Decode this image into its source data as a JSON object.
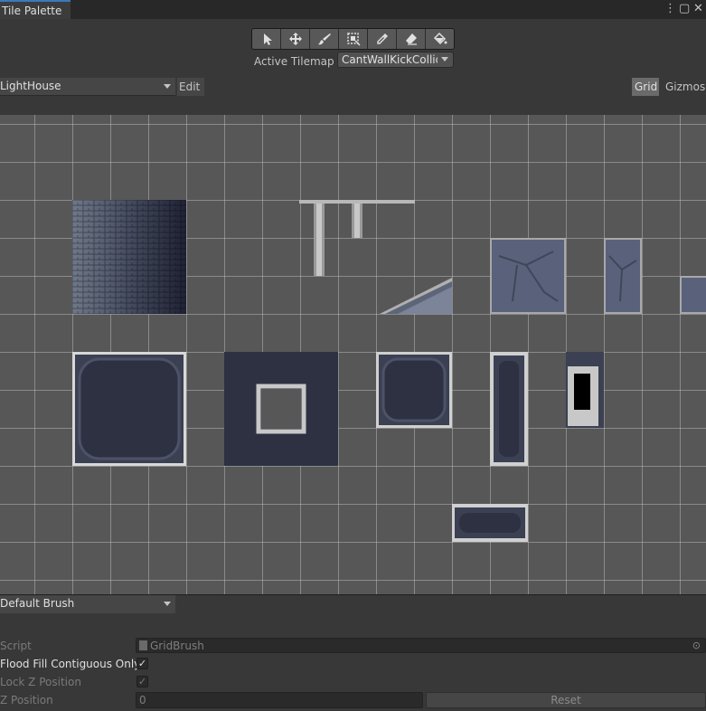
{
  "window": {
    "tab_title": "Tile Palette"
  },
  "tools": [
    {
      "name": "select-tool",
      "icon": "arrow-cursor-icon"
    },
    {
      "name": "move-tool",
      "icon": "move-arrows-icon"
    },
    {
      "name": "paint-tool",
      "icon": "brush-icon"
    },
    {
      "name": "box-fill-tool",
      "icon": "box-select-icon"
    },
    {
      "name": "picker-tool",
      "icon": "eyedropper-icon"
    },
    {
      "name": "erase-tool",
      "icon": "eraser-icon"
    },
    {
      "name": "fill-tool",
      "icon": "paint-bucket-icon"
    }
  ],
  "active_tilemap": {
    "label": "Active Tilemap",
    "value": "CantWallKickCollider"
  },
  "palette": {
    "selected": "LightHouse",
    "edit_label": "Edit",
    "grid_label": "Grid",
    "gizmos_label": "Gizmos"
  },
  "brush": {
    "selected": "Default Brush",
    "script_label": "Script",
    "script_value": "GridBrush",
    "flood_fill_label": "Flood Fill Contiguous Only",
    "flood_fill_checked": "✓",
    "lock_z_label": "Lock Z Position",
    "lock_z_checked": "✓",
    "z_position_label": "Z Position",
    "z_position_value": "0",
    "reset_label": "Reset"
  },
  "colors": {
    "accent": "#3a79bb",
    "canvas_bg": "#575757",
    "panel_bg": "#383838"
  }
}
